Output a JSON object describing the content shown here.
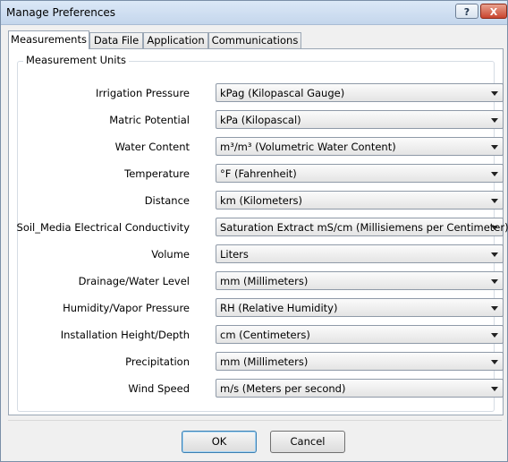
{
  "window": {
    "title": "Manage Preferences",
    "help_label": "?",
    "close_label": "X"
  },
  "tabs": [
    {
      "label": "Measurements",
      "active": true
    },
    {
      "label": "Data File",
      "active": false
    },
    {
      "label": "Application",
      "active": false
    },
    {
      "label": "Communications",
      "active": false
    }
  ],
  "group": {
    "title": "Measurement Units"
  },
  "settings": [
    {
      "label": "Irrigation Pressure",
      "value": "kPag (Kilopascal Gauge)"
    },
    {
      "label": "Matric Potential",
      "value": "kPa (Kilopascal)"
    },
    {
      "label": "Water Content",
      "value": "m³/m³ (Volumetric Water Content)"
    },
    {
      "label": "Temperature",
      "value": "°F (Fahrenheit)"
    },
    {
      "label": "Distance",
      "value": "km (Kilometers)"
    },
    {
      "label": "Soil_Media Electrical Conductivity",
      "value": "Saturation Extract mS/cm (Millisiemens per Centimeter)"
    },
    {
      "label": "Volume",
      "value": "Liters"
    },
    {
      "label": "Drainage/Water Level",
      "value": "mm (Millimeters)"
    },
    {
      "label": "Humidity/Vapor Pressure",
      "value": "RH (Relative Humidity)"
    },
    {
      "label": "Installation Height/Depth",
      "value": "cm (Centimeters)"
    },
    {
      "label": "Precipitation",
      "value": "mm (Millimeters)"
    },
    {
      "label": "Wind Speed",
      "value": "m/s (Meters per second)"
    }
  ],
  "buttons": {
    "ok": "OK",
    "cancel": "Cancel"
  }
}
